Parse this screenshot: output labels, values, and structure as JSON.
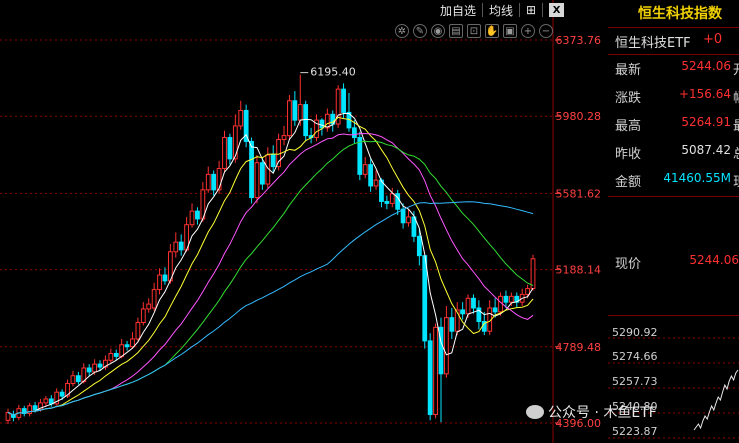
{
  "toolbar": {
    "add_watchlist": "加自选",
    "ma_lines": "均线",
    "close": "X"
  },
  "quote": {
    "index_title": "恒生科技指数",
    "name_label": "恒生科技ETF",
    "name_suffix": "+0",
    "latest_label": "最新",
    "latest_value": "5244.06",
    "latest_tail": "开",
    "change_label": "涨跌",
    "change_value": "+156.64",
    "change_tail": "幅",
    "high_label": "最高",
    "high_value": "5264.91",
    "high_tail": "最",
    "prev_label": "昨收",
    "prev_value": "5087.42",
    "prev_tail": "总",
    "amount_label": "金额",
    "amount_value": "41460.55M",
    "amount_tail": "现",
    "now_label": "现价",
    "now_value": "5244.06",
    "mini_prices": [
      "5290.92",
      "5274.66",
      "5257.73",
      "5240.80",
      "5223.87"
    ]
  },
  "watermark": "公众号 · 木鱼ETF",
  "colors": {
    "up": "#ff3030",
    "down": "#00e5ff",
    "grid": "#8b0000",
    "axis_text": "#ff4040",
    "title": "#f0d000"
  },
  "chart_data": {
    "type": "candlestick",
    "y_axis_ticks": [
      "6373.76",
      "5980.28",
      "5581.62",
      "5188.14",
      "4789.48",
      "4396.00"
    ],
    "ylim": [
      4396.0,
      6373.76
    ],
    "peak_annotation": "6195.40",
    "candles": [
      [
        4410,
        4450,
        4390,
        4470
      ],
      [
        4440,
        4425,
        4405,
        4460
      ],
      [
        4425,
        4470,
        4410,
        4490
      ],
      [
        4470,
        4445,
        4430,
        4485
      ],
      [
        4445,
        4485,
        4430,
        4500
      ],
      [
        4485,
        4465,
        4450,
        4505
      ],
      [
        4465,
        4500,
        4455,
        4520
      ],
      [
        4500,
        4520,
        4480,
        4535
      ],
      [
        4520,
        4495,
        4480,
        4540
      ],
      [
        4495,
        4555,
        4485,
        4575
      ],
      [
        4555,
        4535,
        4515,
        4570
      ],
      [
        4535,
        4600,
        4525,
        4620
      ],
      [
        4600,
        4640,
        4585,
        4665
      ],
      [
        4640,
        4610,
        4595,
        4660
      ],
      [
        4610,
        4680,
        4600,
        4705
      ],
      [
        4680,
        4660,
        4640,
        4700
      ],
      [
        4660,
        4700,
        4645,
        4725
      ],
      [
        4700,
        4685,
        4665,
        4720
      ],
      [
        4685,
        4720,
        4670,
        4745
      ],
      [
        4720,
        4755,
        4705,
        4780
      ],
      [
        4755,
        4740,
        4720,
        4775
      ],
      [
        4740,
        4800,
        4730,
        4830
      ],
      [
        4800,
        4790,
        4770,
        4820
      ],
      [
        4790,
        4830,
        4780,
        4865
      ],
      [
        4830,
        4915,
        4820,
        4940
      ],
      [
        4915,
        4985,
        4900,
        5020
      ],
      [
        4985,
        5010,
        4965,
        5040
      ],
      [
        4990,
        5085,
        4975,
        5120
      ],
      [
        5085,
        5160,
        5060,
        5195
      ],
      [
        5160,
        5130,
        5110,
        5200
      ],
      [
        5130,
        5280,
        5115,
        5320
      ],
      [
        5280,
        5330,
        5250,
        5380
      ],
      [
        5330,
        5290,
        5260,
        5370
      ],
      [
        5290,
        5420,
        5280,
        5460
      ],
      [
        5420,
        5490,
        5405,
        5530
      ],
      [
        5490,
        5450,
        5420,
        5510
      ],
      [
        5450,
        5600,
        5435,
        5640
      ],
      [
        5600,
        5680,
        5585,
        5720
      ],
      [
        5680,
        5600,
        5570,
        5700
      ],
      [
        5600,
        5710,
        5580,
        5750
      ],
      [
        5710,
        5870,
        5690,
        5905
      ],
      [
        5870,
        5760,
        5730,
        5890
      ],
      [
        5760,
        5930,
        5740,
        5990
      ],
      [
        5930,
        6010,
        5910,
        6060
      ],
      [
        6010,
        5850,
        5820,
        6040
      ],
      [
        5850,
        5560,
        5530,
        5870
      ],
      [
        5560,
        5740,
        5530,
        5780
      ],
      [
        5740,
        5630,
        5600,
        5770
      ],
      [
        5630,
        5780,
        5610,
        5820
      ],
      [
        5780,
        5720,
        5690,
        5830
      ],
      [
        5720,
        5860,
        5700,
        5890
      ],
      [
        5860,
        5880,
        5830,
        5930
      ],
      [
        5880,
        6060,
        5860,
        6090
      ],
      [
        6060,
        5960,
        5930,
        6110
      ],
      [
        5960,
        6040,
        5930,
        6195
      ],
      [
        6040,
        5880,
        5850,
        6060
      ],
      [
        5880,
        5870,
        5840,
        5920
      ],
      [
        5870,
        5960,
        5850,
        5990
      ],
      [
        5960,
        5920,
        5880,
        5970
      ],
      [
        5920,
        5990,
        5900,
        6020
      ],
      [
        5990,
        5940,
        5900,
        6010
      ],
      [
        5940,
        6120,
        5920,
        6140
      ],
      [
        6120,
        6000,
        5970,
        6150
      ],
      [
        6000,
        5920,
        5900,
        6100
      ],
      [
        5920,
        5870,
        5840,
        5960
      ],
      [
        5870,
        5680,
        5650,
        5900
      ],
      [
        5680,
        5730,
        5660,
        5770
      ],
      [
        5730,
        5620,
        5590,
        5760
      ],
      [
        5620,
        5650,
        5600,
        5700
      ],
      [
        5650,
        5540,
        5510,
        5660
      ],
      [
        5540,
        5530,
        5500,
        5570
      ],
      [
        5530,
        5580,
        5510,
        5610
      ],
      [
        5580,
        5500,
        5470,
        5600
      ],
      [
        5500,
        5430,
        5400,
        5530
      ],
      [
        5430,
        5460,
        5410,
        5500
      ],
      [
        5460,
        5360,
        5330,
        5490
      ],
      [
        5360,
        5260,
        5210,
        5400
      ],
      [
        5260,
        4820,
        4780,
        5260
      ],
      [
        4820,
        4440,
        4410,
        4860
      ],
      [
        4440,
        4890,
        4420,
        4910
      ],
      [
        4890,
        4650,
        4400,
        4940
      ],
      [
        4650,
        4940,
        4630,
        5000
      ],
      [
        4940,
        4870,
        4830,
        4990
      ],
      [
        4870,
        4980,
        4850,
        5020
      ],
      [
        4980,
        4960,
        4930,
        5020
      ],
      [
        4960,
        5040,
        4940,
        5060
      ],
      [
        5040,
        4990,
        4960,
        5060
      ],
      [
        4990,
        4920,
        4880,
        5030
      ],
      [
        4920,
        4870,
        4850,
        4970
      ],
      [
        4870,
        4990,
        4850,
        5030
      ],
      [
        4990,
        4970,
        4940,
        5040
      ],
      [
        4970,
        5050,
        4950,
        5070
      ],
      [
        5050,
        5020,
        4990,
        5080
      ],
      [
        5020,
        5050,
        5000,
        5070
      ],
      [
        5050,
        5020,
        4990,
        5070
      ],
      [
        5020,
        5060,
        5000,
        5090
      ],
      [
        5060,
        5090,
        5040,
        5110
      ],
      [
        5090,
        5244,
        5080,
        5265
      ]
    ]
  }
}
